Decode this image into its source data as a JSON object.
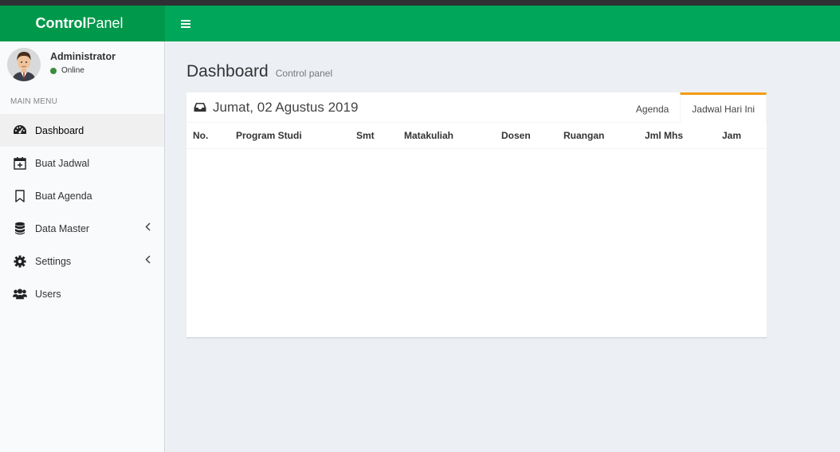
{
  "header": {
    "logo_bold": "Control",
    "logo_regular": "Panel",
    "toggle_icon": "hamburger-icon",
    "colors": {
      "logo_bg": "#00984a",
      "navbar_bg": "#00a65a"
    }
  },
  "user": {
    "name": "Administrator",
    "status": "Online"
  },
  "sidebar": {
    "header": "MAIN MENU",
    "items": [
      {
        "label": "Dashboard",
        "icon": "dashboard-icon",
        "active": true
      },
      {
        "label": "Buat Jadwal",
        "icon": "calendar-plus-icon"
      },
      {
        "label": "Buat Agenda",
        "icon": "bookmark-icon"
      },
      {
        "label": "Data Master",
        "icon": "database-icon",
        "expandable": true
      },
      {
        "label": "Settings",
        "icon": "gear-icon",
        "expandable": true
      },
      {
        "label": "Users",
        "icon": "users-icon"
      }
    ]
  },
  "page": {
    "title": "Dashboard",
    "subtitle": "Control panel"
  },
  "box": {
    "title": "Jumat, 02 Agustus 2019",
    "title_icon": "inbox-icon",
    "tabs": [
      {
        "label": "Agenda",
        "active": false
      },
      {
        "label": "Jadwal Hari Ini",
        "active": true
      }
    ],
    "columns": [
      "No.",
      "Program Studi",
      "Smt",
      "Matakuliah",
      "Dosen",
      "Ruangan",
      "Jml Mhs",
      "Jam"
    ],
    "rows": []
  }
}
